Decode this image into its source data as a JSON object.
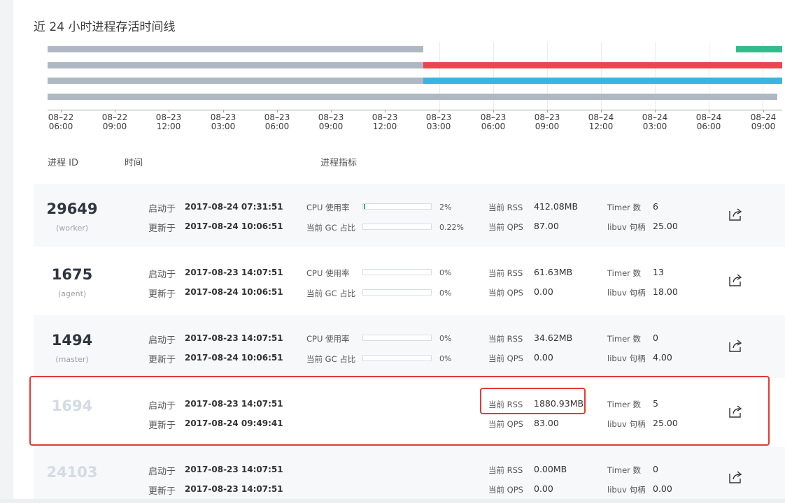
{
  "timeline": {
    "title": "近 24 小时进程存活时间线",
    "bar_colors": {
      "gray": "#aeb8c4",
      "red": "#e9474e",
      "blue": "#3ab4e0",
      "green": "#36ba8c"
    },
    "ticks": [
      {
        "date": "08–22",
        "time": "06:00"
      },
      {
        "date": "08–22",
        "time": "09:00"
      },
      {
        "date": "08–23",
        "time": "12:00"
      },
      {
        "date": "08–23",
        "time": "03:00"
      },
      {
        "date": "08–23",
        "time": "06:00"
      },
      {
        "date": "08–23",
        "time": "09:00"
      },
      {
        "date": "08–23",
        "time": "12:00"
      },
      {
        "date": "08–23",
        "time": "03:00"
      },
      {
        "date": "08–23",
        "time": "06:00"
      },
      {
        "date": "08–23",
        "time": "09:00"
      },
      {
        "date": "08–24",
        "time": "12:00"
      },
      {
        "date": "08–24",
        "time": "03:00"
      },
      {
        "date": "08–24",
        "time": "06:00"
      },
      {
        "date": "08–24",
        "time": "09:00"
      }
    ]
  },
  "table": {
    "col_pid": "进程 ID",
    "col_time": "时间",
    "col_metrics": "进程指标"
  },
  "labels": {
    "started": "启动于",
    "updated": "更新于",
    "cpu": "CPU 使用率",
    "gc": "当前 GC 占比",
    "rss": "当前 RSS",
    "qps": "当前 QPS",
    "timer": "Timer 数",
    "libuv": "libuv 句柄"
  },
  "rows": [
    {
      "pid": "29649",
      "role": "(worker)",
      "started": "2017-08-24 07:31:51",
      "updated": "2017-08-24 10:06:51",
      "cpu_pct": "2%",
      "cpu_value": 0.02,
      "gc_pct": "0.22%",
      "gc_value": 0.0022,
      "rss": "412.08MB",
      "qps": "87.00",
      "timer": "6",
      "libuv": "25.00"
    },
    {
      "pid": "1675",
      "role": "(agent)",
      "started": "2017-08-23 14:07:51",
      "updated": "2017-08-24 10:06:51",
      "cpu_pct": "0%",
      "cpu_value": 0,
      "gc_pct": "0%",
      "gc_value": 0,
      "rss": "61.63MB",
      "qps": "0.00",
      "timer": "13",
      "libuv": "18.00"
    },
    {
      "pid": "1494",
      "role": "(master)",
      "started": "2017-08-23 14:07:51",
      "updated": "2017-08-24 10:06:51",
      "cpu_pct": "0%",
      "cpu_value": 0,
      "gc_pct": "0%",
      "gc_value": 0,
      "rss": "34.62MB",
      "qps": "0.00",
      "timer": "0",
      "libuv": "4.00"
    },
    {
      "pid": "1694",
      "role": "",
      "started": "2017-08-23 14:07:51",
      "updated": "2017-08-24 09:49:41",
      "rss": "1880.93MB",
      "qps": "83.00",
      "timer": "5",
      "libuv": "25.00"
    },
    {
      "pid": "24103",
      "role": "",
      "started": "2017-08-23 14:07:51",
      "updated": "2017-08-23 14:07:51",
      "rss": "0.00MB",
      "qps": "0.00",
      "timer": "0",
      "libuv": "0.00"
    }
  ],
  "icons": {
    "open": "external-open-icon"
  },
  "highlight_color": "#e53935"
}
